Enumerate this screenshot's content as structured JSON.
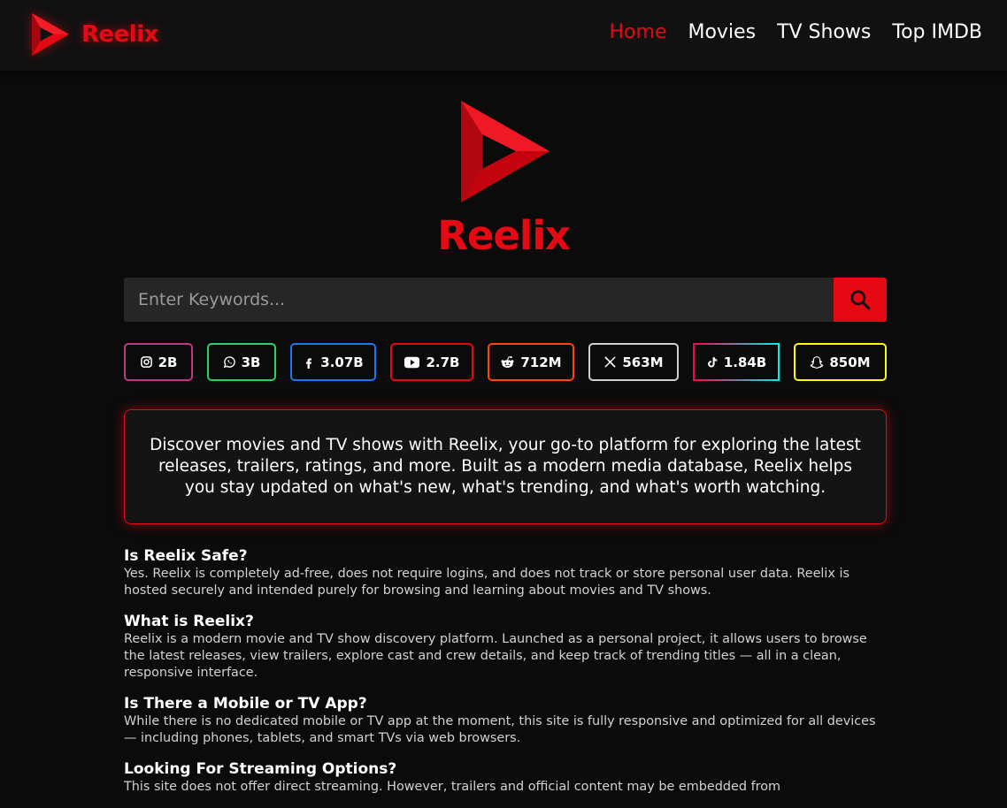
{
  "brand": {
    "name": "Reelix",
    "accent_color": "#e50914"
  },
  "nav": {
    "links": [
      {
        "label": "Home",
        "active": true
      },
      {
        "label": "Movies",
        "active": false
      },
      {
        "label": "TV Shows",
        "active": false
      },
      {
        "label": "Top IMDB",
        "active": false
      }
    ]
  },
  "hero": {
    "title": "Reelix"
  },
  "search": {
    "placeholder": "Enter Keywords...",
    "value": "",
    "button_icon": "search-icon"
  },
  "social": [
    {
      "icon": "instagram-icon",
      "count": "2B",
      "color": "#c13584"
    },
    {
      "icon": "whatsapp-icon",
      "count": "3B",
      "color": "#25d366"
    },
    {
      "icon": "facebook-icon",
      "count": "3.07B",
      "color": "#1877f2"
    },
    {
      "icon": "youtube-icon",
      "count": "2.7B",
      "color": "#e50914"
    },
    {
      "icon": "reddit-icon",
      "count": "712M",
      "color": "#ff4500"
    },
    {
      "icon": "x-icon",
      "count": "563M",
      "color": "#cfcfcf"
    },
    {
      "icon": "tiktok-icon",
      "count": "1.84B",
      "color": "#ff0050"
    },
    {
      "icon": "snapchat-icon",
      "count": "850M",
      "color": "#fffc00"
    }
  ],
  "intro": {
    "text": "Discover movies and TV shows with Reelix, your go-to platform for exploring the latest releases, trailers, ratings, and more. Built as a modern media database, Reelix helps you stay updated on what's new, what's trending, and what's worth watching."
  },
  "faq": [
    {
      "question": "Is Reelix Safe?",
      "answer": "Yes. Reelix is completely ad-free, does not require logins, and does not track or store personal user data. Reelix is hosted securely and intended purely for browsing and learning about movies and TV shows."
    },
    {
      "question": "What is Reelix?",
      "answer": "Reelix is a modern movie and TV show discovery platform. Launched as a personal project, it allows users to browse the latest releases, view trailers, explore cast and crew details, and keep track of trending titles — all in a clean, responsive interface."
    },
    {
      "question": "Is There a Mobile or TV App?",
      "answer": "While there is no dedicated mobile or TV app at the moment, this site is fully responsive and optimized for all devices — including phones, tablets, and smart TVs via web browsers."
    },
    {
      "question": "Looking For Streaming Options?",
      "answer": "This site does not offer direct streaming. However, trailers and official content may be embedded from"
    }
  ]
}
